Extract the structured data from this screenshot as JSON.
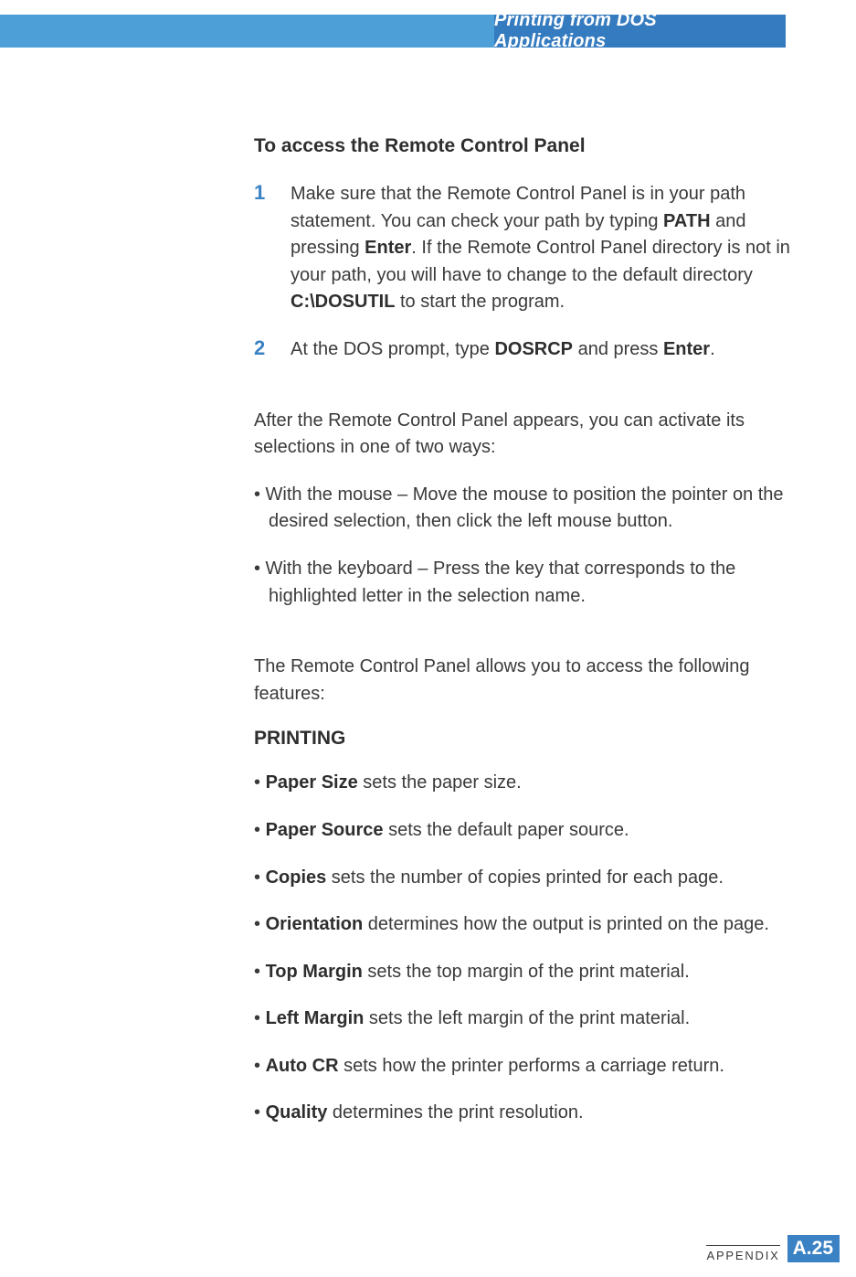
{
  "header": {
    "title": "Printing from DOS Applications"
  },
  "section_title": "To access the Remote Control Panel",
  "steps": [
    {
      "num": "1",
      "pre": "Make sure that the Remote Control Panel is in your path statement. You can check your path by typing ",
      "b1": "PATH",
      "mid1": " and pressing ",
      "b2": "Enter",
      "mid2": ". If the Remote Control Panel directory is not in your path, you will have to change to the default directory ",
      "b3": "C:\\DOSUTIL",
      "post": " to start the program."
    },
    {
      "num": "2",
      "pre": "At the DOS prompt, type ",
      "b1": "DOSRCP",
      "mid1": " and press ",
      "b2": "Enter",
      "mid2": ".",
      "b3": "",
      "post": ""
    }
  ],
  "after_para": "After the Remote Control Panel appears, you can activate its selections in one of two ways:",
  "activate_bullets": [
    "• With the mouse – Move the mouse to position the pointer on the desired selection, then click the left mouse button.",
    "• With the keyboard – Press the key that corresponds to the highlighted letter in the selection name."
  ],
  "features_para": "The Remote Control Panel allows you to access the following features:",
  "printing_head": "PRINTING",
  "printing_bullets": [
    {
      "label": "Paper Size",
      "text": " sets the paper size."
    },
    {
      "label": "Paper Source",
      "text": " sets the default paper source."
    },
    {
      "label": "Copies",
      "text": " sets the number of copies printed for each page."
    },
    {
      "label": "Orientation",
      "text": " determines how the output is printed on the page."
    },
    {
      "label": "Top Margin",
      "text": " sets the top margin of the print material."
    },
    {
      "label": "Left Margin",
      "text": " sets the left margin of the print material."
    },
    {
      "label": "Auto CR",
      "text": " sets how the printer performs a carriage return."
    },
    {
      "label": "Quality",
      "text": " determines the print resolution."
    }
  ],
  "footer": {
    "appendix": "APPENDIX",
    "page_prefix": "A.",
    "page_num": "25"
  }
}
